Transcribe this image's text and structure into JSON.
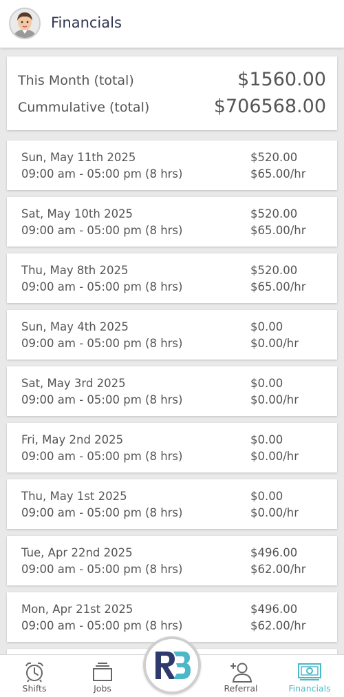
{
  "header": {
    "title": "Financials",
    "avatar_icon": "user-avatar-icon"
  },
  "summary": {
    "month_label": "This Month (total)",
    "month_value": "$1560.00",
    "cumulative_label": "Cummulative (total)",
    "cumulative_value": "$706568.00"
  },
  "shifts": [
    {
      "date": "Sun, May 11th 2025",
      "time": "09:00 am - 05:00 pm (8 hrs)",
      "amount": "$520.00",
      "rate": "$65.00/hr"
    },
    {
      "date": "Sat, May 10th 2025",
      "time": "09:00 am - 05:00 pm (8 hrs)",
      "amount": "$520.00",
      "rate": "$65.00/hr"
    },
    {
      "date": "Thu, May 8th 2025",
      "time": "09:00 am - 05:00 pm (8 hrs)",
      "amount": "$520.00",
      "rate": "$65.00/hr"
    },
    {
      "date": "Sun, May 4th 2025",
      "time": "09:00 am - 05:00 pm (8 hrs)",
      "amount": "$0.00",
      "rate": "$0.00/hr"
    },
    {
      "date": "Sat, May 3rd 2025",
      "time": "09:00 am - 05:00 pm (8 hrs)",
      "amount": "$0.00",
      "rate": "$0.00/hr"
    },
    {
      "date": "Fri, May 2nd 2025",
      "time": "09:00 am - 05:00 pm (8 hrs)",
      "amount": "$0.00",
      "rate": "$0.00/hr"
    },
    {
      "date": "Thu, May 1st 2025",
      "time": "09:00 am - 05:00 pm (8 hrs)",
      "amount": "$0.00",
      "rate": "$0.00/hr"
    },
    {
      "date": "Tue, Apr 22nd 2025",
      "time": "09:00 am - 05:00 pm (8 hrs)",
      "amount": "$496.00",
      "rate": "$62.00/hr"
    },
    {
      "date": "Mon, Apr 21st 2025",
      "time": "09:00 am - 05:00 pm (8 hrs)",
      "amount": "$496.00",
      "rate": "$62.00/hr"
    }
  ],
  "tabbar": {
    "shifts": {
      "label": "Shifts",
      "icon": "alarm-clock-icon"
    },
    "jobs": {
      "label": "Jobs",
      "icon": "stack-icon"
    },
    "center": {
      "icon": "rb-logo-icon"
    },
    "referral": {
      "label": "Referral",
      "icon": "add-user-icon"
    },
    "financials": {
      "label": "Financials",
      "icon": "money-icon"
    }
  },
  "colors": {
    "accent": "#4ab8c8",
    "logo_navy": "#2e3a6e",
    "text": "#555555",
    "title": "#2e3550"
  }
}
